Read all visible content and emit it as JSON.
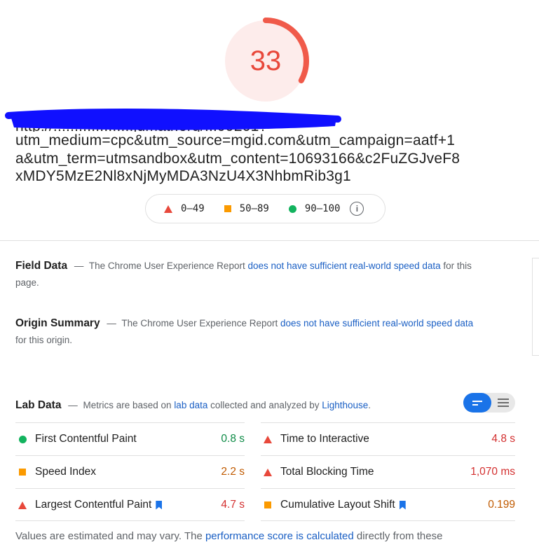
{
  "score": {
    "value": "33",
    "color": "#e8483b",
    "ring_fraction": 0.33
  },
  "url": {
    "partial_line": "http://...................jdmatr.org/...99201?",
    "lines": [
      "utm_medium=cpc&utm_source=mgid.com&utm_campaign=aatf+1",
      "a&utm_term=utmsandbox&utm_content=10693166&c2FuZGJveF8",
      "xMDY5MzE2Nl8xNjMyMDA3NzU4X3NhbmRib3g1"
    ]
  },
  "legend": {
    "items": [
      {
        "icon": "triangle-icon",
        "label": "0–49",
        "color": "#e8483b"
      },
      {
        "icon": "square-icon",
        "label": "50–89",
        "color": "#fb9a00"
      },
      {
        "icon": "circle-icon",
        "label": "90–100",
        "color": "#12b35e"
      }
    ],
    "info_icon": "i"
  },
  "field_data": {
    "title": "Field Data",
    "dash": "—",
    "text_before": "The Chrome User Experience Report ",
    "link": "does not have sufficient real-world speed data",
    "text_after": " for this page."
  },
  "origin_summary": {
    "title": "Origin Summary",
    "dash": "—",
    "text_before": "The Chrome User Experience Report ",
    "link": "does not have sufficient real-world speed data",
    "text_after": " for this origin."
  },
  "lab_data": {
    "title": "Lab Data",
    "dash": "—",
    "text_1": "Metrics are based on ",
    "link_1": "lab data",
    "text_2": " collected and analyzed by ",
    "link_2": "Lighthouse",
    "text_3": "."
  },
  "metrics_left": [
    {
      "name": "First Contentful Paint",
      "value": "0.8 s",
      "status": "pass"
    },
    {
      "name": "Speed Index",
      "value": "2.2 s",
      "status": "average"
    },
    {
      "name": "Largest Contentful Paint",
      "value": "4.7 s",
      "status": "fail",
      "bookmark": true
    }
  ],
  "metrics_right": [
    {
      "name": "Time to Interactive",
      "value": "4.8 s",
      "status": "fail"
    },
    {
      "name": "Total Blocking Time",
      "value": "1,070 ms",
      "status": "fail"
    },
    {
      "name": "Cumulative Layout Shift",
      "value": "0.199",
      "status": "average",
      "bookmark": true
    }
  ],
  "footer": {
    "text_1": "Values are estimated and may vary. The ",
    "link": "performance score is calculated",
    "text_2": " directly from these"
  },
  "colors": {
    "accent": "#1a73e8",
    "link": "#1a5fc4",
    "redaction": "#1010ff"
  }
}
